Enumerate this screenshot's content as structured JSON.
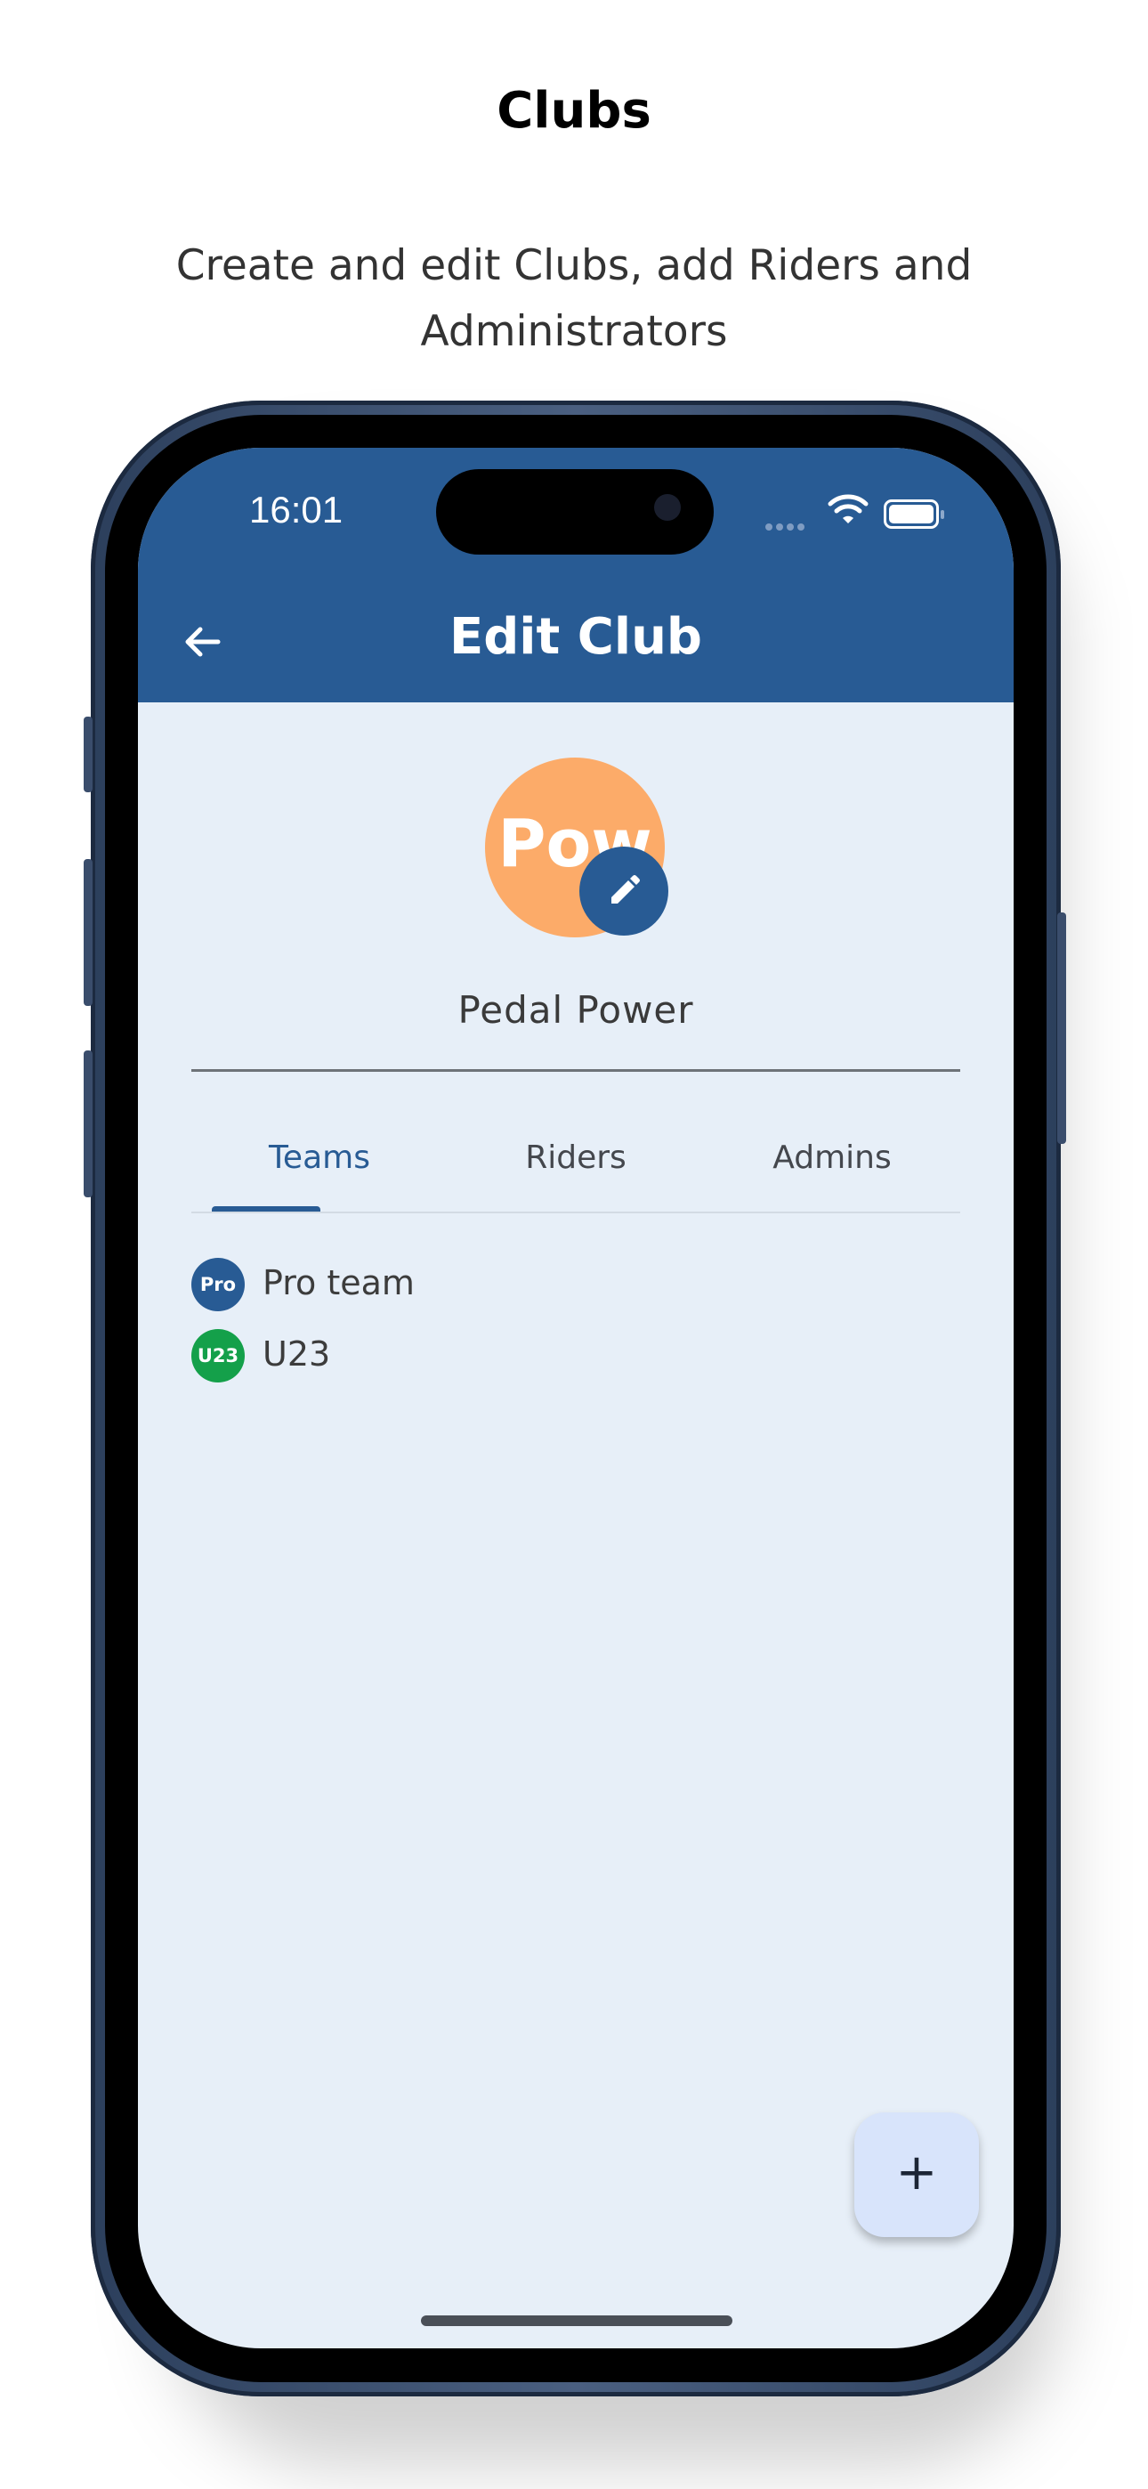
{
  "header": {
    "title": "Clubs",
    "subtitle": "Create and edit Clubs, add Riders and Administrators"
  },
  "status_bar": {
    "time": "16:01"
  },
  "app_bar": {
    "title": "Edit Club",
    "back_icon": "arrow-left-icon"
  },
  "club": {
    "avatar_text": "Pow",
    "avatar_color": "#fcab69",
    "edit_icon": "pencil-icon",
    "name": "Pedal Power"
  },
  "tabs": [
    {
      "label": "Teams",
      "active": true
    },
    {
      "label": "Riders",
      "active": false
    },
    {
      "label": "Admins",
      "active": false
    }
  ],
  "teams": [
    {
      "badge": "Pro",
      "name": "Pro team",
      "color": "#285b94"
    },
    {
      "badge": "U23",
      "name": "U23",
      "color": "#14a04a"
    }
  ],
  "fab": {
    "label": "+",
    "icon": "plus-icon"
  },
  "colors": {
    "primary": "#285b94",
    "background": "#e7eff8",
    "fab": "#d8e4fb"
  }
}
